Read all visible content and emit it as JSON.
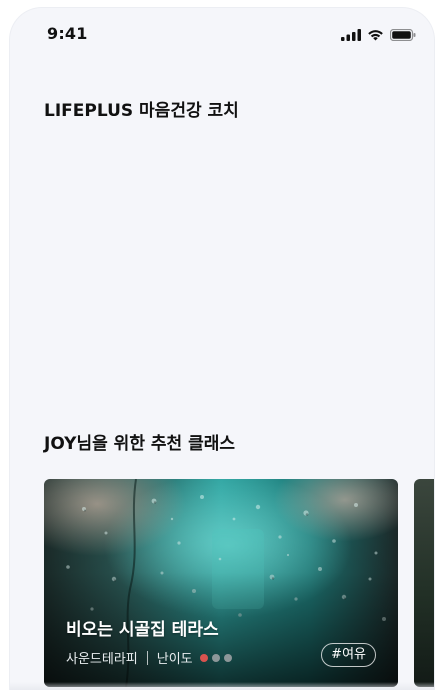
{
  "status_bar": {
    "time": "9:41",
    "icons": [
      "signal-icon",
      "wifi-icon",
      "battery-icon"
    ]
  },
  "header": {
    "title": "LIFEPLUS 마음건강 코치"
  },
  "recommend": {
    "section_title": "JOY님을 위한 추천 클래스",
    "cards": [
      {
        "title": "비오는 시골집 테라스",
        "category": "사운드테라피",
        "difficulty_label": "난이도",
        "difficulty_level": 1,
        "difficulty_max": 3,
        "tag": "#여유"
      }
    ]
  },
  "colors": {
    "background": "#f5f6fa",
    "text": "#111111",
    "difficulty_active": "#d9534f",
    "difficulty_inactive": "#8d9799",
    "card_teal": "#1f8f8f"
  }
}
